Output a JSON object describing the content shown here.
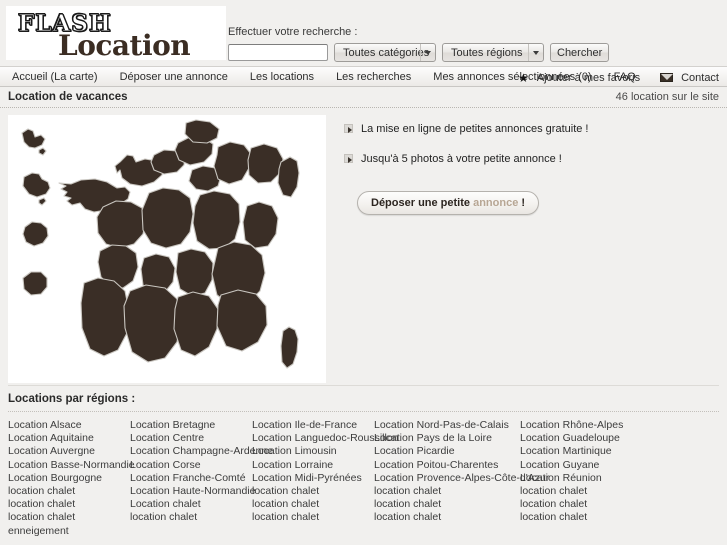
{
  "brand": {
    "logo_top": "FLASH",
    "logo_bottom": "Location"
  },
  "search": {
    "label": "Effectuer votre recherche :",
    "input_value": "",
    "input_placeholder": "",
    "category_selected": "Toutes catégories",
    "region_selected": "Toutes régions",
    "submit_label": "Chercher"
  },
  "nav": {
    "items": [
      {
        "label": "Accueil (La carte)"
      },
      {
        "label": "Déposer une annonce"
      },
      {
        "label": "Les locations"
      },
      {
        "label": "Les recherches"
      },
      {
        "label": "Mes annonces sélectionnées (0)"
      },
      {
        "label": "FAQ"
      }
    ],
    "favorites_label": "Ajouter à mes favoris",
    "contact_label": "Contact",
    "star_icon": "star-icon",
    "mail_icon": "envelope-icon"
  },
  "subbar": {
    "title": "Location de vacances",
    "count": "46 location sur le site"
  },
  "promo": {
    "lines": [
      "La mise en ligne de petites annonces gratuite !",
      "Jusqu'à 5 photos à votre petite annonce !"
    ],
    "cta_main": "Déposer une petite",
    "cta_soft": "annonce",
    "cta_bang": "!"
  },
  "map": {
    "name": "france-regions-map",
    "fill_color": "#3a2e26",
    "border_color": "#c9c6c0",
    "background": "#ffffff"
  },
  "footer": {
    "title": "Locations par régions :",
    "columns": [
      [
        "Location Alsace",
        "Location Aquitaine",
        "Location Auvergne",
        "Location Basse-Normandie",
        "Location Bourgogne",
        "location chalet",
        "location chalet",
        "location chalet",
        "enneigement"
      ],
      [
        "Location Bretagne",
        "Location Centre",
        "Location Champagne-Ardenne",
        "Location Corse",
        "Location Franche-Comté",
        "Location Haute-Normandie",
        "Location chalet",
        "location chalet"
      ],
      [
        "Location Ile-de-France",
        "Location Languedoc-Roussillon",
        "Location Limousin",
        "Location Lorraine",
        "Location Midi-Pyrénées",
        "location chalet",
        "location chalet",
        "location chalet"
      ],
      [
        "Location Nord-Pas-de-Calais",
        "Location Pays de la Loire",
        "Location Picardie",
        "Location Poitou-Charentes",
        "Location Provence-Alpes-Côte-d'Azur",
        "location chalet",
        "location chalet",
        "location chalet"
      ],
      [
        "Location Rhône-Alpes",
        "Location Guadeloupe",
        "Location Martinique",
        "Location Guyane",
        "Location Réunion",
        "location chalet",
        "location chalet",
        "location chalet"
      ]
    ]
  }
}
